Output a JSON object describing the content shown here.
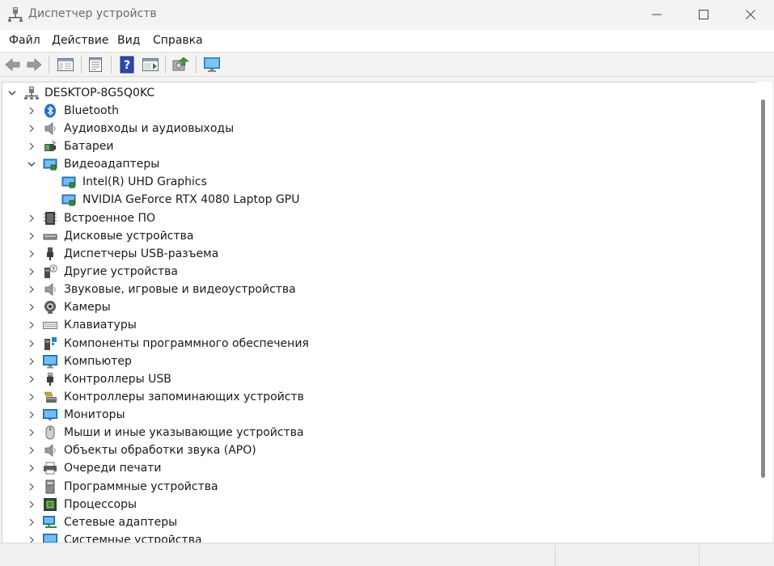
{
  "window": {
    "title": "Диспетчер устройств"
  },
  "menu": [
    {
      "id": "file",
      "label": "Файл"
    },
    {
      "id": "action",
      "label": "Действие"
    },
    {
      "id": "view",
      "label": "Вид"
    },
    {
      "id": "help",
      "label": "Справка"
    }
  ],
  "toolbar": [
    {
      "id": "back",
      "icon": "back-arrow-icon"
    },
    {
      "id": "forward",
      "icon": "forward-arrow-icon"
    },
    {
      "id": "show-hide-tree",
      "icon": "console-tree-icon"
    },
    {
      "id": "properties",
      "icon": "properties-icon"
    },
    {
      "id": "help",
      "icon": "help-icon"
    },
    {
      "id": "update-driver",
      "icon": "update-driver-icon"
    },
    {
      "id": "scan-hardware",
      "icon": "scan-hardware-icon"
    },
    {
      "id": "show-computer",
      "icon": "monitor-icon"
    }
  ],
  "tree": {
    "root": {
      "label": "DESKTOP-8G5Q0KC",
      "expanded": true,
      "icon": "computer-tower-icon"
    },
    "items": [
      {
        "label": "Bluetooth",
        "icon": "bluetooth-icon",
        "expanded": false
      },
      {
        "label": "Аудиовходы и аудиовыходы",
        "icon": "speaker-icon",
        "expanded": false
      },
      {
        "label": "Батареи",
        "icon": "battery-icon",
        "expanded": false
      },
      {
        "label": "Видеоадаптеры",
        "icon": "display-adapter-icon",
        "expanded": true,
        "children": [
          {
            "label": "Intel(R) UHD Graphics",
            "icon": "display-adapter-icon"
          },
          {
            "label": "NVIDIA GeForce RTX 4080 Laptop GPU",
            "icon": "display-adapter-icon"
          }
        ]
      },
      {
        "label": "Встроенное ПО",
        "icon": "firmware-icon",
        "expanded": false
      },
      {
        "label": "Дисковые устройства",
        "icon": "disk-drive-icon",
        "expanded": false
      },
      {
        "label": "Диспетчеры USB-разъема",
        "icon": "usb-connector-icon",
        "expanded": false
      },
      {
        "label": "Другие устройства",
        "icon": "unknown-device-icon",
        "expanded": false
      },
      {
        "label": "Звуковые, игровые и видеоустройства",
        "icon": "speaker-icon",
        "expanded": false
      },
      {
        "label": "Камеры",
        "icon": "webcam-icon",
        "expanded": false
      },
      {
        "label": "Клавиатуры",
        "icon": "keyboard-icon",
        "expanded": false
      },
      {
        "label": "Компоненты программного обеспечения",
        "icon": "software-component-icon",
        "expanded": false
      },
      {
        "label": "Компьютер",
        "icon": "monitor-icon",
        "expanded": false
      },
      {
        "label": "Контроллеры USB",
        "icon": "usb-plug-icon",
        "expanded": false
      },
      {
        "label": "Контроллеры запоминающих устройств",
        "icon": "storage-controller-icon",
        "expanded": false
      },
      {
        "label": "Мониторы",
        "icon": "monitor-icon",
        "expanded": false
      },
      {
        "label": "Мыши и иные указывающие устройства",
        "icon": "mouse-icon",
        "expanded": false
      },
      {
        "label": "Объекты обработки звука (APO)",
        "icon": "speaker-icon",
        "expanded": false
      },
      {
        "label": "Очереди печати",
        "icon": "printer-icon",
        "expanded": false
      },
      {
        "label": "Программные устройства",
        "icon": "software-device-icon",
        "expanded": false
      },
      {
        "label": "Процессоры",
        "icon": "processor-icon",
        "expanded": false
      },
      {
        "label": "Сетевые адаптеры",
        "icon": "network-adapter-icon",
        "expanded": false
      },
      {
        "label": "Системные устройства",
        "icon": "system-device-icon",
        "expanded": false
      }
    ]
  },
  "colors": {
    "window_bg": "#f3f3f3",
    "content_bg": "#ffffff",
    "title_text": "#6b6b6b",
    "bluetooth": "#1f6fd6",
    "monitor_blue": "#2f8fd8",
    "scrollbar_thumb": "#8a8a8a"
  }
}
